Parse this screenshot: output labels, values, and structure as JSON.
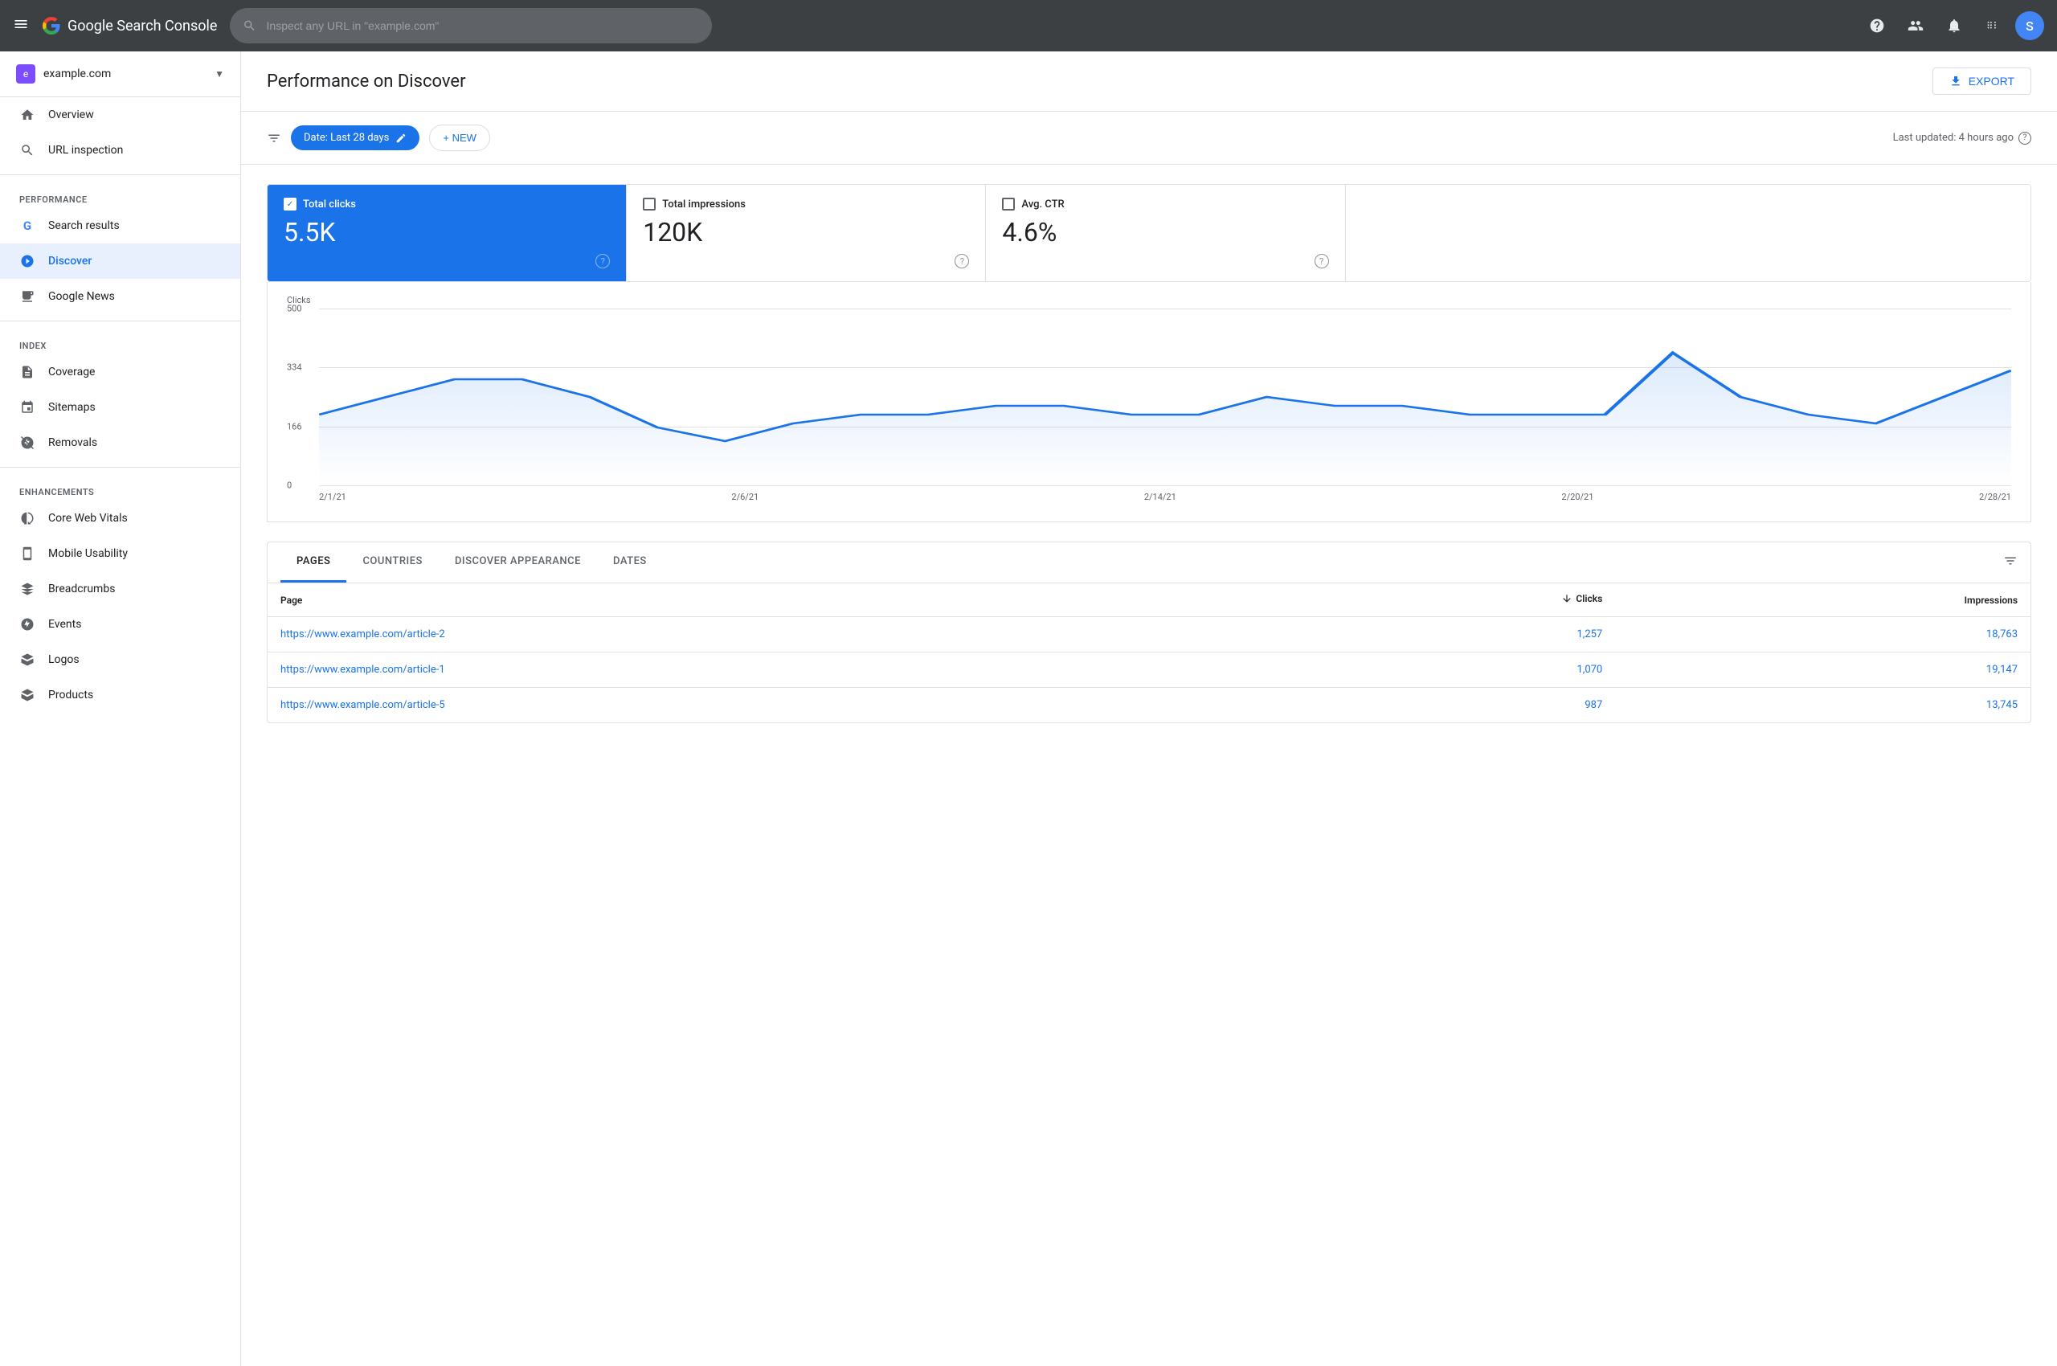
{
  "topbar": {
    "app_name": "Google Search Console",
    "search_placeholder": "Inspect any URL in \"example.com\"",
    "user_initial": "S"
  },
  "sidebar": {
    "site": "example.com",
    "nav": {
      "overview_label": "Overview",
      "url_inspection_label": "URL inspection",
      "performance_section": "Performance",
      "performance_items": [
        {
          "label": "Search results",
          "icon": "G"
        },
        {
          "label": "Discover",
          "icon": "*",
          "active": true
        },
        {
          "label": "Google News",
          "icon": "N"
        }
      ],
      "index_section": "Index",
      "index_items": [
        {
          "label": "Coverage"
        },
        {
          "label": "Sitemaps"
        },
        {
          "label": "Removals"
        }
      ],
      "enhancements_section": "Enhancements",
      "enhancements_items": [
        {
          "label": "Core Web Vitals"
        },
        {
          "label": "Mobile Usability"
        },
        {
          "label": "Breadcrumbs"
        },
        {
          "label": "Events"
        },
        {
          "label": "Logos"
        },
        {
          "label": "Products"
        }
      ]
    }
  },
  "page": {
    "title": "Performance on Discover",
    "export_label": "EXPORT",
    "filter_bar": {
      "date_filter": "Date: Last 28 days",
      "new_label": "+ NEW",
      "last_updated": "Last updated: 4 hours ago"
    },
    "metrics": [
      {
        "label": "Total clicks",
        "value": "5.5K",
        "active": true
      },
      {
        "label": "Total impressions",
        "value": "120K",
        "active": false
      },
      {
        "label": "Avg. CTR",
        "value": "4.6%",
        "active": false
      }
    ],
    "chart": {
      "y_label": "Clicks",
      "y_ticks": [
        "500",
        "334",
        "166",
        "0"
      ],
      "x_labels": [
        "2/1/21",
        "2/6/21",
        "2/14/21",
        "2/20/21",
        "2/28/21"
      ]
    },
    "table": {
      "tabs": [
        "PAGES",
        "COUNTRIES",
        "DISCOVER APPEARANCE",
        "DATES"
      ],
      "active_tab": "PAGES",
      "columns": [
        "Page",
        "Clicks",
        "Impressions"
      ],
      "rows": [
        {
          "page": "https://www.example.com/article-2",
          "clicks": "1,257",
          "impressions": "18,763"
        },
        {
          "page": "https://www.example.com/article-1",
          "clicks": "1,070",
          "impressions": "19,147"
        },
        {
          "page": "https://www.example.com/article-5",
          "clicks": "987",
          "impressions": "13,745"
        }
      ]
    }
  }
}
